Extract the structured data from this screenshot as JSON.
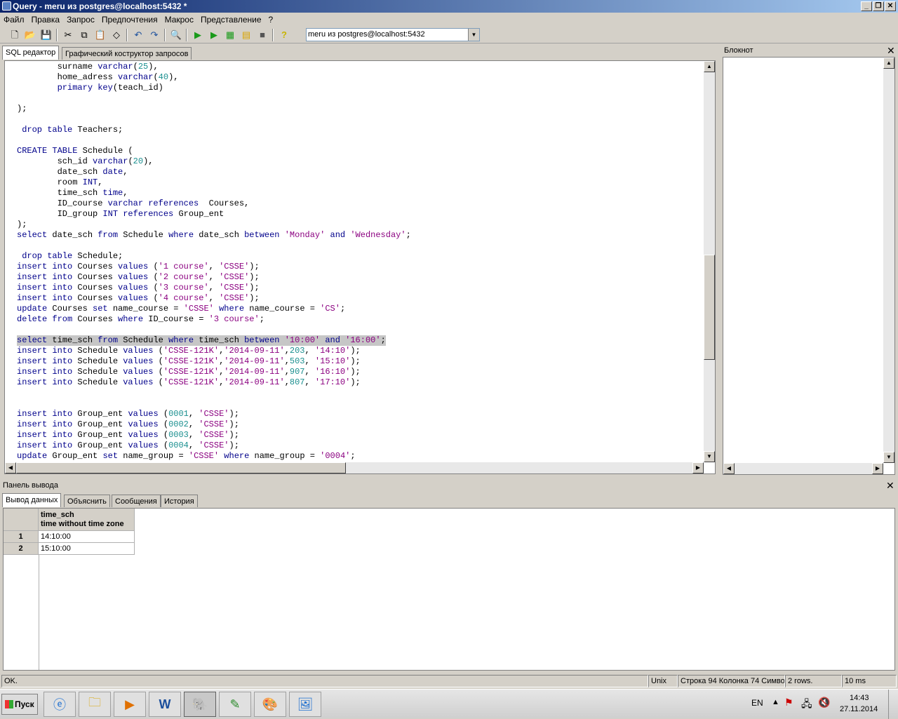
{
  "window": {
    "title": "Query - meru из postgres@localhost:5432 *"
  },
  "menu": [
    "Файл",
    "Правка",
    "Запрос",
    "Предпочтения",
    "Макрос",
    "Представление",
    "?"
  ],
  "toolbar": {
    "icons": [
      "new-file-icon",
      "open-folder-icon",
      "save-icon",
      "cut-icon",
      "copy-icon",
      "paste-icon",
      "clear-icon",
      "undo-icon",
      "redo-icon",
      "find-icon",
      "execute-icon",
      "execute-to-file-icon",
      "explain-icon",
      "explain-analyze-icon",
      "stop-icon",
      "help-icon"
    ],
    "connection": "meru из postgres@localhost:5432"
  },
  "tabs": {
    "sql_editor": "SQL редактор",
    "graphical_builder": "Графический коструктор запросов"
  },
  "notepad": {
    "title": "Блокнот"
  },
  "code_lines": [
    [
      [
        "",
        "        surname "
      ],
      [
        "kw",
        "varchar"
      ],
      [
        "",
        "("
      ],
      [
        "num",
        "25"
      ],
      [
        "",
        "),"
      ]
    ],
    [
      [
        "",
        "        home_adress "
      ],
      [
        "kw",
        "varchar"
      ],
      [
        "",
        "("
      ],
      [
        "num",
        "40"
      ],
      [
        "",
        "),"
      ]
    ],
    [
      [
        "",
        "        "
      ],
      [
        "kw",
        "primary key"
      ],
      [
        "",
        "(teach_id)"
      ]
    ],
    [],
    [
      [
        "",
        ");"
      ]
    ],
    [],
    [
      [
        "",
        " "
      ],
      [
        "kw",
        "drop table"
      ],
      [
        "",
        " Teachers;"
      ]
    ],
    [],
    [
      [
        "kw",
        "CREATE TABLE"
      ],
      [
        "",
        " Schedule ("
      ]
    ],
    [
      [
        "",
        "        sch_id "
      ],
      [
        "kw",
        "varchar"
      ],
      [
        "",
        "("
      ],
      [
        "num",
        "20"
      ],
      [
        "",
        "),"
      ]
    ],
    [
      [
        "",
        "        date_sch "
      ],
      [
        "kw",
        "date"
      ],
      [
        "",
        ","
      ]
    ],
    [
      [
        "",
        "        room "
      ],
      [
        "kw",
        "INT"
      ],
      [
        "",
        ","
      ]
    ],
    [
      [
        "",
        "        time_sch "
      ],
      [
        "kw",
        "time"
      ],
      [
        "",
        ","
      ]
    ],
    [
      [
        "",
        "        ID_course "
      ],
      [
        "kw",
        "varchar references"
      ],
      [
        "",
        "  Courses,"
      ]
    ],
    [
      [
        "",
        "        ID_group "
      ],
      [
        "kw",
        "INT references"
      ],
      [
        "",
        " Group_ent"
      ]
    ],
    [
      [
        "",
        ");"
      ]
    ],
    [
      [
        "kw",
        "select"
      ],
      [
        "",
        " date_sch "
      ],
      [
        "kw",
        "from"
      ],
      [
        "",
        " Schedule "
      ],
      [
        "kw",
        "where"
      ],
      [
        "",
        " date_sch "
      ],
      [
        "kw",
        "between"
      ],
      [
        "",
        " "
      ],
      [
        "str",
        "'Monday'"
      ],
      [
        "",
        " "
      ],
      [
        "kw",
        "and"
      ],
      [
        "",
        " "
      ],
      [
        "str",
        "'Wednesday'"
      ],
      [
        "",
        ";"
      ]
    ],
    [],
    [
      [
        "",
        " "
      ],
      [
        "kw",
        "drop table"
      ],
      [
        "",
        " Schedule;"
      ]
    ],
    [
      [
        "kw",
        "insert into"
      ],
      [
        "",
        " Courses "
      ],
      [
        "kw",
        "values"
      ],
      [
        "",
        " ("
      ],
      [
        "str",
        "'1 course'"
      ],
      [
        "",
        ", "
      ],
      [
        "str",
        "'CSSE'"
      ],
      [
        "",
        ");"
      ]
    ],
    [
      [
        "kw",
        "insert into"
      ],
      [
        "",
        " Courses "
      ],
      [
        "kw",
        "values"
      ],
      [
        "",
        " ("
      ],
      [
        "str",
        "'2 course'"
      ],
      [
        "",
        ", "
      ],
      [
        "str",
        "'CSSE'"
      ],
      [
        "",
        ");"
      ]
    ],
    [
      [
        "kw",
        "insert into"
      ],
      [
        "",
        " Courses "
      ],
      [
        "kw",
        "values"
      ],
      [
        "",
        " ("
      ],
      [
        "str",
        "'3 course'"
      ],
      [
        "",
        ", "
      ],
      [
        "str",
        "'CSSE'"
      ],
      [
        "",
        ");"
      ]
    ],
    [
      [
        "kw",
        "insert into"
      ],
      [
        "",
        " Courses "
      ],
      [
        "kw",
        "values"
      ],
      [
        "",
        " ("
      ],
      [
        "str",
        "'4 course'"
      ],
      [
        "",
        ", "
      ],
      [
        "str",
        "'CSSE'"
      ],
      [
        "",
        ");"
      ]
    ],
    [
      [
        "kw",
        "update"
      ],
      [
        "",
        " Courses "
      ],
      [
        "kw",
        "set"
      ],
      [
        "",
        " name_course = "
      ],
      [
        "str",
        "'CSSE'"
      ],
      [
        "",
        " "
      ],
      [
        "kw",
        "where"
      ],
      [
        "",
        " name_course = "
      ],
      [
        "str",
        "'CS'"
      ],
      [
        "",
        ";"
      ]
    ],
    [
      [
        "kw",
        "delete from"
      ],
      [
        "",
        " Courses "
      ],
      [
        "kw",
        "where"
      ],
      [
        "",
        " ID_course = "
      ],
      [
        "str",
        "'3 course'"
      ],
      [
        "",
        ";"
      ]
    ],
    [],
    [
      [
        "kw",
        "select"
      ],
      [
        "",
        " time_sch "
      ],
      [
        "kw",
        "from"
      ],
      [
        "",
        " Schedule "
      ],
      [
        "kw",
        "where"
      ],
      [
        "",
        " time_sch "
      ],
      [
        "kw",
        "between"
      ],
      [
        "",
        " "
      ],
      [
        "str",
        "'10:00'"
      ],
      [
        "",
        " "
      ],
      [
        "kw",
        "and"
      ],
      [
        "",
        " "
      ],
      [
        "str",
        "'16:00'"
      ],
      [
        "",
        ";"
      ]
    ],
    [
      [
        "kw",
        "insert into"
      ],
      [
        "",
        " Schedule "
      ],
      [
        "kw",
        "values"
      ],
      [
        "",
        " ("
      ],
      [
        "str",
        "'CSSE-121K'"
      ],
      [
        "",
        ","
      ],
      [
        "str",
        "'2014-09-11'"
      ],
      [
        "",
        ","
      ],
      [
        "num",
        "203"
      ],
      [
        "",
        ", "
      ],
      [
        "str",
        "'14:10'"
      ],
      [
        "",
        ");"
      ]
    ],
    [
      [
        "kw",
        "insert into"
      ],
      [
        "",
        " Schedule "
      ],
      [
        "kw",
        "values"
      ],
      [
        "",
        " ("
      ],
      [
        "str",
        "'CSSE-121K'"
      ],
      [
        "",
        ","
      ],
      [
        "str",
        "'2014-09-11'"
      ],
      [
        "",
        ","
      ],
      [
        "num",
        "503"
      ],
      [
        "",
        ", "
      ],
      [
        "str",
        "'15:10'"
      ],
      [
        "",
        ");"
      ]
    ],
    [
      [
        "kw",
        "insert into"
      ],
      [
        "",
        " Schedule "
      ],
      [
        "kw",
        "values"
      ],
      [
        "",
        " ("
      ],
      [
        "str",
        "'CSSE-121K'"
      ],
      [
        "",
        ","
      ],
      [
        "str",
        "'2014-09-11'"
      ],
      [
        "",
        ","
      ],
      [
        "num",
        "907"
      ],
      [
        "",
        ", "
      ],
      [
        "str",
        "'16:10'"
      ],
      [
        "",
        ");"
      ]
    ],
    [
      [
        "kw",
        "insert into"
      ],
      [
        "",
        " Schedule "
      ],
      [
        "kw",
        "values"
      ],
      [
        "",
        " ("
      ],
      [
        "str",
        "'CSSE-121K'"
      ],
      [
        "",
        ","
      ],
      [
        "str",
        "'2014-09-11'"
      ],
      [
        "",
        ","
      ],
      [
        "num",
        "807"
      ],
      [
        "",
        ", "
      ],
      [
        "str",
        "'17:10'"
      ],
      [
        "",
        ");"
      ]
    ],
    [],
    [],
    [
      [
        "kw",
        "insert into"
      ],
      [
        "",
        " Group_ent "
      ],
      [
        "kw",
        "values"
      ],
      [
        "",
        " ("
      ],
      [
        "num",
        "0001"
      ],
      [
        "",
        ", "
      ],
      [
        "str",
        "'CSSE'"
      ],
      [
        "",
        ");"
      ]
    ],
    [
      [
        "kw",
        "insert into"
      ],
      [
        "",
        " Group_ent "
      ],
      [
        "kw",
        "values"
      ],
      [
        "",
        " ("
      ],
      [
        "num",
        "0002"
      ],
      [
        "",
        ", "
      ],
      [
        "str",
        "'CSSE'"
      ],
      [
        "",
        ");"
      ]
    ],
    [
      [
        "kw",
        "insert into"
      ],
      [
        "",
        " Group_ent "
      ],
      [
        "kw",
        "values"
      ],
      [
        "",
        " ("
      ],
      [
        "num",
        "0003"
      ],
      [
        "",
        ", "
      ],
      [
        "str",
        "'CSSE'"
      ],
      [
        "",
        ");"
      ]
    ],
    [
      [
        "kw",
        "insert into"
      ],
      [
        "",
        " Group_ent "
      ],
      [
        "kw",
        "values"
      ],
      [
        "",
        " ("
      ],
      [
        "num",
        "0004"
      ],
      [
        "",
        ", "
      ],
      [
        "str",
        "'CSSE'"
      ],
      [
        "",
        ");"
      ]
    ],
    [
      [
        "kw",
        "update"
      ],
      [
        "",
        " Group_ent "
      ],
      [
        "kw",
        "set"
      ],
      [
        "",
        " name_group = "
      ],
      [
        "str",
        "'CSSE'"
      ],
      [
        "",
        " "
      ],
      [
        "kw",
        "where"
      ],
      [
        "",
        " name_group = "
      ],
      [
        "str",
        "'0004'"
      ],
      [
        "",
        ";"
      ]
    ]
  ],
  "highlighted_line": 26,
  "output": {
    "title": "Панель вывода",
    "tabs": [
      "Вывод данных",
      "Объяснить",
      "Сообщения",
      "История"
    ],
    "column": {
      "name": "time_sch",
      "type": "time without time zone"
    },
    "rows": [
      {
        "n": "1",
        "value": "14:10:00"
      },
      {
        "n": "2",
        "value": "15:10:00"
      }
    ]
  },
  "status": {
    "message": "OK.",
    "eol": "Unix",
    "position": "Строка 94 Колонка 74 Симво",
    "rows": "2 rows.",
    "time": "10 ms"
  },
  "taskbar": {
    "start": "Пуск",
    "apps": [
      "internet-explorer-icon",
      "file-manager-icon",
      "media-player-icon",
      "word-icon",
      "pgadmin-icon",
      "notepadpp-icon",
      "paint-icon",
      "image-viewer-icon"
    ],
    "lang": "EN",
    "time": "14:43",
    "date": "27.11.2014"
  }
}
